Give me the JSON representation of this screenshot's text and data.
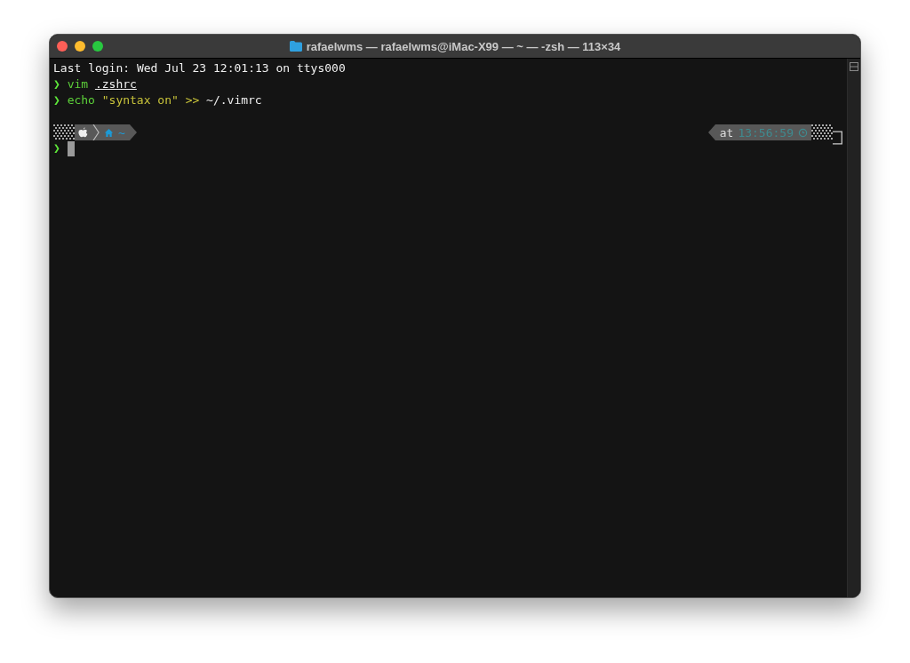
{
  "window": {
    "title": "rafaelwms — rafaelwms@iMac-X99 — ~ — -zsh — 113×34"
  },
  "lines": [
    {
      "kind": "plain",
      "segments": [
        {
          "kind": "plain",
          "text": "Last login: Wed Jul 23 12:01:13 on ttys000"
        }
      ]
    },
    {
      "kind": "command",
      "prompt": "❯",
      "segments": [
        {
          "kind": "cmd",
          "text": "vim"
        },
        {
          "kind": "path",
          "text": ".zshrc"
        }
      ]
    },
    {
      "kind": "command",
      "prompt": "❯",
      "segments": [
        {
          "kind": "cmd",
          "text": "echo"
        },
        {
          "kind": "string",
          "text": "\"syntax on\""
        },
        {
          "kind": "operator",
          "text": ">>"
        },
        {
          "kind": "plain",
          "text": "~/.vimrc"
        }
      ]
    }
  ],
  "prompt_bar": {
    "dir": "~",
    "right_label": "at",
    "time": "13:56:59"
  },
  "input_line": {
    "prompt": "❯"
  }
}
